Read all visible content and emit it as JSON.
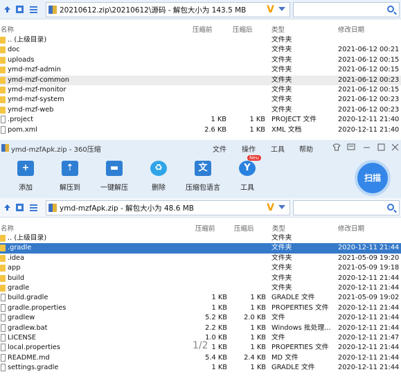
{
  "top": {
    "path": "20210612.zip\\20210612\\源码 - 解包大小为 143.5 MB",
    "columns": [
      "名称",
      "压缩前",
      "压缩后",
      "类型",
      "修改日期"
    ],
    "rows": [
      {
        "name": ".. (上级目录)",
        "before": "",
        "after": "",
        "type": "文件夹",
        "date": "",
        "kind": "folder"
      },
      {
        "name": "doc",
        "before": "",
        "after": "",
        "type": "文件夹",
        "date": "2021-06-12 00:21",
        "kind": "folder"
      },
      {
        "name": "uploads",
        "before": "",
        "after": "",
        "type": "文件夹",
        "date": "2021-06-12 00:15",
        "kind": "folder"
      },
      {
        "name": "ymd-mzf-admin",
        "before": "",
        "after": "",
        "type": "文件夹",
        "date": "2021-06-12 00:15",
        "kind": "folder"
      },
      {
        "name": "ymd-mzf-common",
        "before": "",
        "after": "",
        "type": "文件夹",
        "date": "2021-06-12 00:23",
        "kind": "folder"
      },
      {
        "name": "ymd-mzf-monitor",
        "before": "",
        "after": "",
        "type": "文件夹",
        "date": "2021-06-12 00:15",
        "kind": "folder"
      },
      {
        "name": "ymd-mzf-system",
        "before": "",
        "after": "",
        "type": "文件夹",
        "date": "2021-06-12 00:23",
        "kind": "folder"
      },
      {
        "name": "ymd-mzf-web",
        "before": "",
        "after": "",
        "type": "文件夹",
        "date": "2021-06-12 00:23",
        "kind": "folder"
      },
      {
        "name": ".project",
        "before": "1 KB",
        "after": "1 KB",
        "type": "PROJECT 文件",
        "date": "2020-12-11 21:40",
        "kind": "file"
      },
      {
        "name": "pom.xml",
        "before": "2.6 KB",
        "after": "1 KB",
        "type": "XML 文档",
        "date": "2020-12-11 21:40",
        "kind": "file"
      }
    ]
  },
  "window": {
    "title": "ymd-mzfApk.zip - 360压缩",
    "menu": [
      "文件",
      "操作",
      "工具",
      "帮助"
    ],
    "toolbar": [
      "添加",
      "解压到",
      "一键解压",
      "删除",
      "压缩包语言",
      "工具"
    ],
    "badge": "Neu",
    "scan": "扫描",
    "path": "ymd-mzfApk.zip - 解包大小为 48.6 MB",
    "columns": [
      "名称",
      "压缩前",
      "压缩后",
      "类型",
      "修改日期"
    ],
    "rows": [
      {
        "name": ".. (上级目录)",
        "before": "",
        "after": "",
        "type": "文件夹",
        "date": "",
        "kind": "folder"
      },
      {
        "name": ".gradle",
        "before": "",
        "after": "",
        "type": "文件夹",
        "date": "2020-12-11 21:44",
        "kind": "folder"
      },
      {
        "name": ".idea",
        "before": "",
        "after": "",
        "type": "文件夹",
        "date": "2021-05-09 19:20",
        "kind": "folder"
      },
      {
        "name": "app",
        "before": "",
        "after": "",
        "type": "文件夹",
        "date": "2021-05-09 19:18",
        "kind": "folder"
      },
      {
        "name": "build",
        "before": "",
        "after": "",
        "type": "文件夹",
        "date": "2020-12-11 21:44",
        "kind": "folder"
      },
      {
        "name": "gradle",
        "before": "",
        "after": "",
        "type": "文件夹",
        "date": "2020-12-11 21:44",
        "kind": "folder"
      },
      {
        "name": "build.gradle",
        "before": "1 KB",
        "after": "1 KB",
        "type": "GRADLE 文件",
        "date": "2021-05-09 19:02",
        "kind": "file"
      },
      {
        "name": "gradle.properties",
        "before": "1 KB",
        "after": "1 KB",
        "type": "PROPERTIES 文件",
        "date": "2020-12-11 21:44",
        "kind": "file"
      },
      {
        "name": "gradlew",
        "before": "5.2 KB",
        "after": "2.0 KB",
        "type": "文件",
        "date": "2020-12-11 21:44",
        "kind": "file"
      },
      {
        "name": "gradlew.bat",
        "before": "2.2 KB",
        "after": "1 KB",
        "type": "Windows 批处理...",
        "date": "2020-12-11 21:44",
        "kind": "file"
      },
      {
        "name": "LICENSE",
        "before": "1.0 KB",
        "after": "1 KB",
        "type": "文件",
        "date": "2020-12-11 21:47",
        "kind": "file"
      },
      {
        "name": "local.properties",
        "before": "1 KB",
        "after": "1 KB",
        "type": "PROPERTIES 文件",
        "date": "2020-12-11 21:44",
        "kind": "file"
      },
      {
        "name": "README.md",
        "before": "5.4 KB",
        "after": "2.4 KB",
        "type": "MD 文件",
        "date": "2020-12-11 21:44",
        "kind": "file"
      },
      {
        "name": "settings.gradle",
        "before": "1 KB",
        "after": "1 KB",
        "type": "GRADLE 文件",
        "date": "2020-12-11 21:44",
        "kind": "file"
      }
    ]
  },
  "pager": "1/2"
}
